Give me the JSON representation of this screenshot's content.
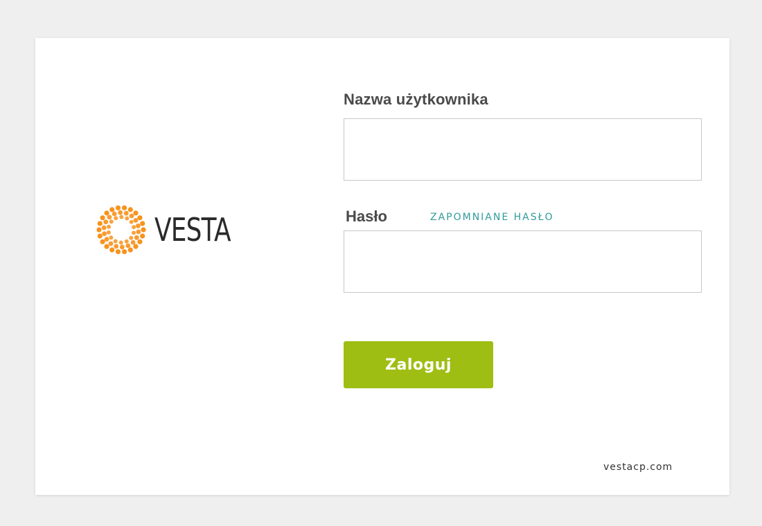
{
  "login": {
    "username_label": "Nazwa użytkownika",
    "username_value": "",
    "password_label": "Hasło",
    "password_value": "",
    "forgot_password_link": "ZAPOMNIANE HASŁO",
    "submit_label": "Zaloguj"
  },
  "brand": {
    "logo_text": "VESTA",
    "logo_icon": "vesta-ring-logo-icon",
    "logo_color": "#f7931e"
  },
  "footer": {
    "link_text": "vestacp.com"
  },
  "colors": {
    "background": "#efefef",
    "card": "#ffffff",
    "button": "#9ebe14",
    "link": "#2f9b9b",
    "label": "#4a4a4a"
  }
}
